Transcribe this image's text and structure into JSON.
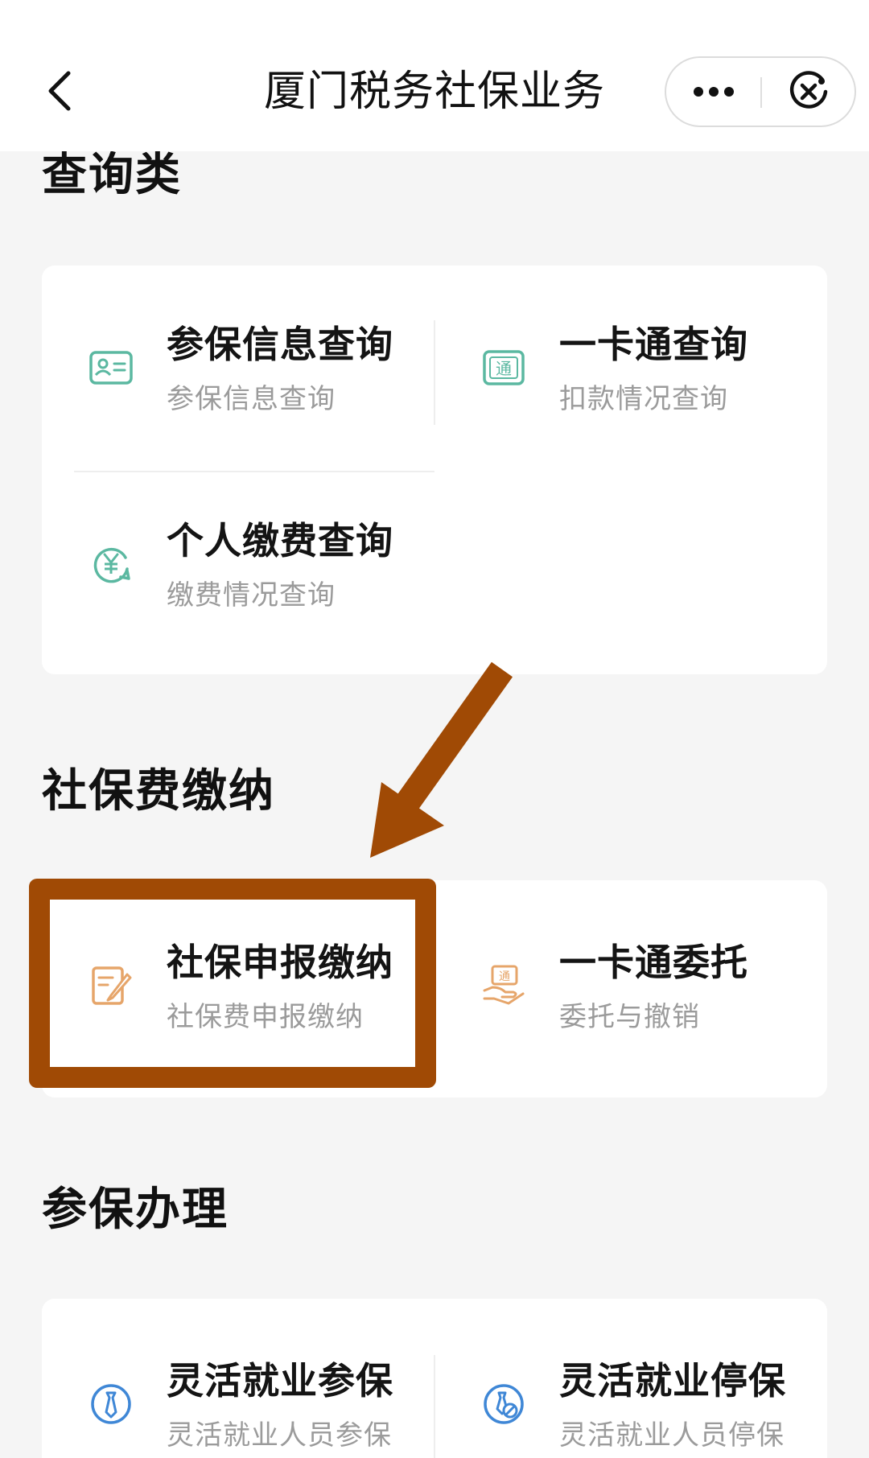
{
  "navbar": {
    "title": "厦门税务社保业务"
  },
  "icons": {
    "back": "chevron-left-icon",
    "more": "more-dots-icon",
    "close": "close-circle-icon"
  },
  "colors": {
    "accent_green": "#5bb8a1",
    "accent_orange": "#e6a56a",
    "accent_blue": "#3f87d6",
    "annotation_brown": "#a04a05"
  },
  "sections": {
    "query": {
      "title": "查询类",
      "items": [
        {
          "title": "参保信息查询",
          "subtitle": "参保信息查询",
          "icon": "id-card-icon"
        },
        {
          "title": "一卡通查询",
          "subtitle": "扣款情况查询",
          "icon": "card-tong-icon"
        },
        {
          "title": "个人缴费查询",
          "subtitle": "缴费情况查询",
          "icon": "yuan-refresh-icon"
        }
      ]
    },
    "payment": {
      "title": "社保费缴纳",
      "items": [
        {
          "title": "社保申报缴纳",
          "subtitle": "社保费申报缴纳",
          "icon": "edit-document-icon"
        },
        {
          "title": "一卡通委托",
          "subtitle": "委托与撤销",
          "icon": "hand-card-icon"
        }
      ]
    },
    "enroll": {
      "title": "参保办理",
      "items": [
        {
          "title": "灵活就业参保",
          "subtitle": "灵活就业人员参保",
          "icon": "tie-circle-icon"
        },
        {
          "title": "灵活就业停保",
          "subtitle": "灵活就业人员停保",
          "icon": "pause-circle-icon"
        }
      ]
    }
  }
}
